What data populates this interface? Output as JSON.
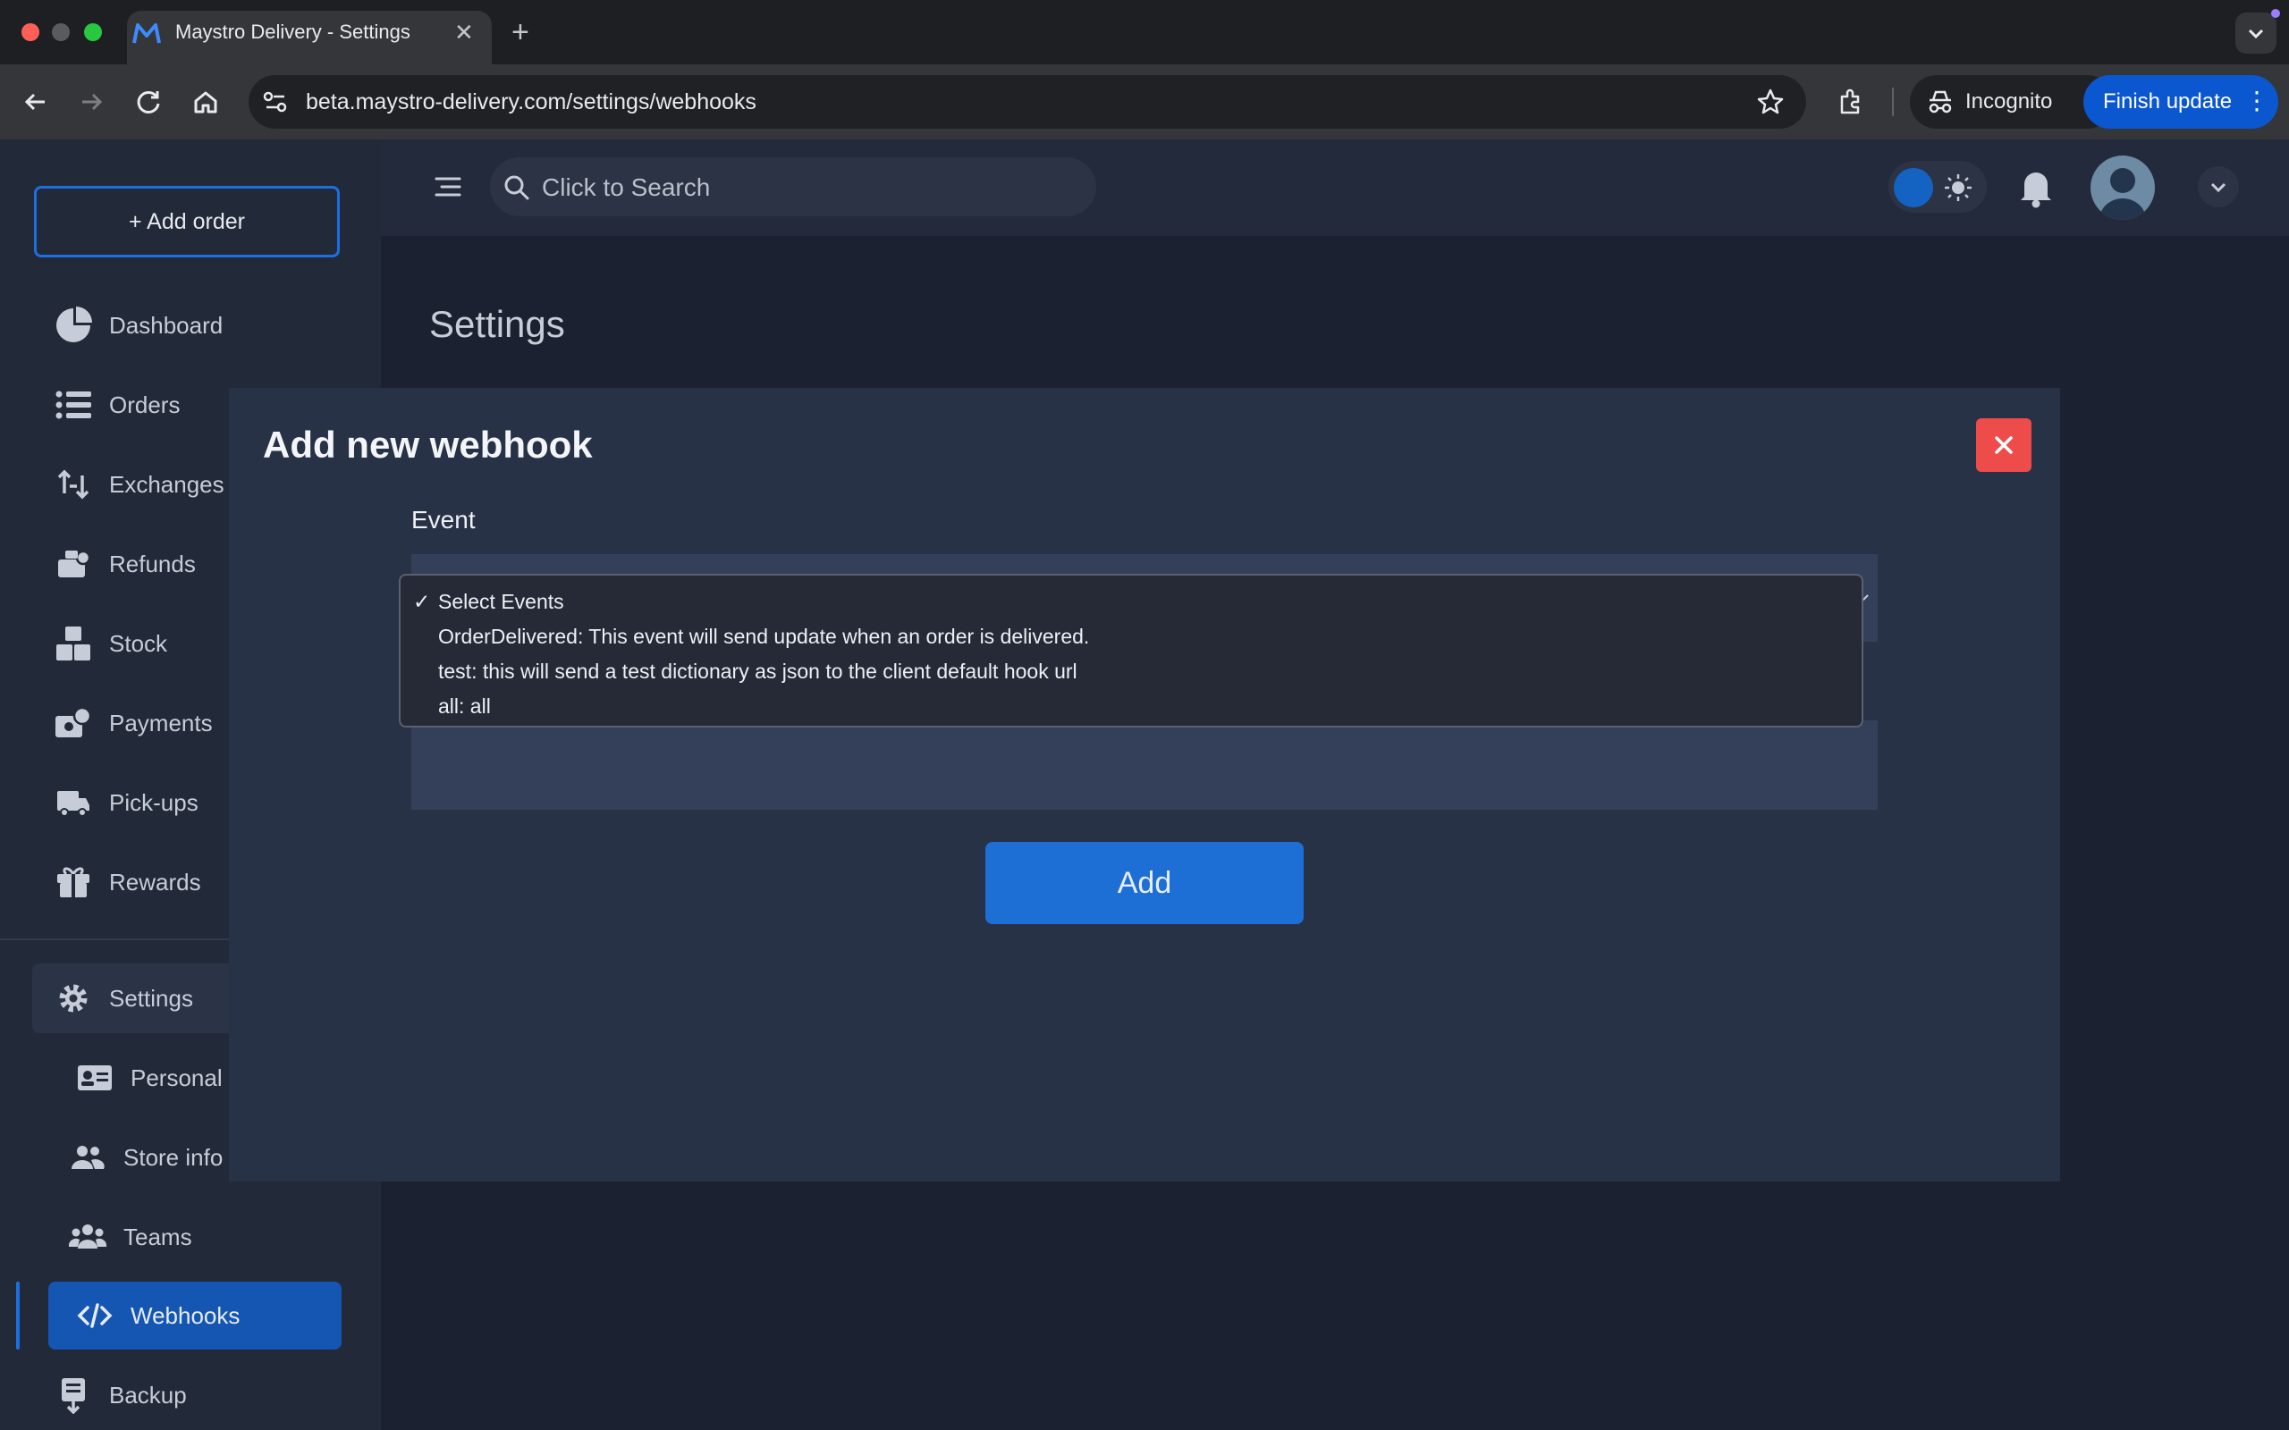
{
  "browser": {
    "tab_title": "Maystro Delivery - Settings",
    "tab_close": "✕",
    "new_tab": "+",
    "url": "beta.maystro-delivery.com/settings/webhooks",
    "incognito_label": "Incognito",
    "finish_update_label": "Finish update"
  },
  "header": {
    "search_placeholder": "Click to Search"
  },
  "sidebar": {
    "add_order_label": "+ Add order",
    "items": [
      {
        "label": "Dashboard",
        "icon": "pie-chart-icon"
      },
      {
        "label": "Orders",
        "icon": "list-icon"
      },
      {
        "label": "Exchanges",
        "icon": "exchange-icon"
      },
      {
        "label": "Refunds",
        "icon": "refund-icon"
      },
      {
        "label": "Stock",
        "icon": "boxes-icon"
      },
      {
        "label": "Payments",
        "icon": "cash-icon"
      },
      {
        "label": "Pick-ups",
        "icon": "truck-icon"
      },
      {
        "label": "Rewards",
        "icon": "gift-icon"
      }
    ],
    "settings": {
      "label": "Settings",
      "icon": "gear-icon",
      "children": [
        {
          "label": "Personal",
          "icon": "id-card-icon"
        },
        {
          "label": "Store info",
          "icon": "users-icon"
        },
        {
          "label": "Teams",
          "icon": "team-icon"
        },
        {
          "label": "Webhooks",
          "icon": "code-icon"
        }
      ]
    },
    "backup": {
      "label": "Backup",
      "icon": "backup-icon"
    }
  },
  "page": {
    "title": "Settings"
  },
  "modal": {
    "title": "Add new webhook",
    "close_symbol": "✕",
    "event_label": "Event",
    "add_button_label": "Add",
    "dropdown": {
      "selected": "Select Events",
      "check": "✓",
      "options": [
        "Select Events",
        "OrderDelivered: This event will send update when an order is delivered.",
        "test: this will send a test dictionary as json to the client default hook url",
        "all: all"
      ]
    }
  },
  "colors": {
    "accent": "#1d6fe0",
    "danger": "#ee4b4b",
    "modal_bg": "#283246",
    "page_bg": "#1b2130"
  }
}
